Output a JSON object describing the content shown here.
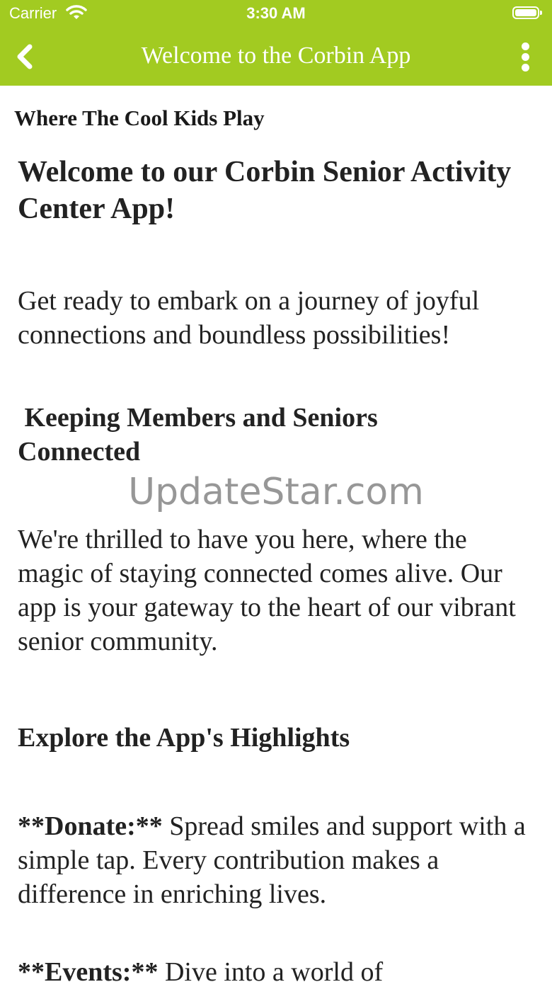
{
  "status_bar": {
    "carrier": "Carrier",
    "time": "3:30 AM"
  },
  "nav": {
    "title": "Welcome to the Corbin App",
    "back_icon": "chevron-left-icon",
    "more_icon": "more-vertical-icon"
  },
  "content": {
    "tagline": "Where The Cool Kids Play",
    "welcome_heading": "Welcome to our Corbin Senior Activity Center App!",
    "intro": "Get ready to embark on a journey of joyful connections and boundless possibilities!",
    "connected_heading": " Keeping Members and Seniors Connected",
    "watermark": "UpdateStar.com",
    "thrilled": "We're thrilled to have you here, where the magic of staying connected comes alive. Our app is your gateway to the heart of our vibrant senior community.",
    "highlights_heading": "Explore the App's Highlights",
    "donate_lead": "**Donate:**",
    "donate_text": " Spread smiles and support with a simple tap. Every contribution makes a difference in enriching lives.",
    "events_lead": "**Events:**",
    "events_text": " Dive into a world of"
  },
  "colors": {
    "accent": "#a2cb21",
    "text": "#222222",
    "watermark": "#8f8f8f"
  }
}
